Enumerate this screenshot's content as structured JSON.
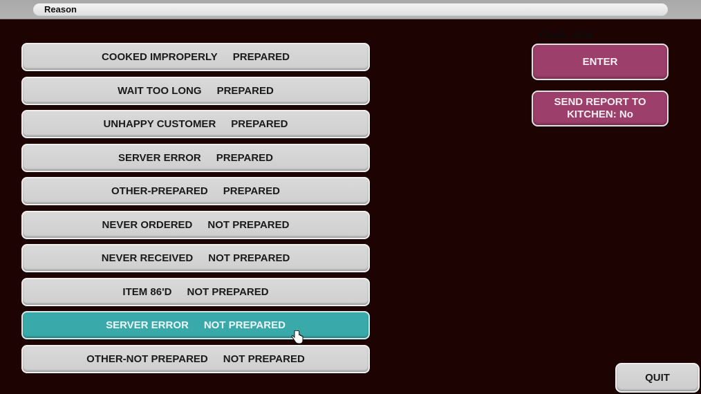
{
  "header": {
    "title": "Reason"
  },
  "check": {
    "label": "Check: 0004"
  },
  "reasons": [
    {
      "name": "COOKED IMPROPERLY",
      "status": "PREPARED",
      "selected": false
    },
    {
      "name": "WAIT TOO LONG",
      "status": "PREPARED",
      "selected": false
    },
    {
      "name": "UNHAPPY CUSTOMER",
      "status": "PREPARED",
      "selected": false
    },
    {
      "name": "SERVER ERROR",
      "status": "PREPARED",
      "selected": false
    },
    {
      "name": "OTHER-PREPARED",
      "status": "PREPARED",
      "selected": false
    },
    {
      "name": "NEVER ORDERED",
      "status": "NOT PREPARED",
      "selected": false
    },
    {
      "name": "NEVER RECEIVED",
      "status": "NOT PREPARED",
      "selected": false
    },
    {
      "name": "ITEM 86'D",
      "status": "NOT PREPARED",
      "selected": false
    },
    {
      "name": "SERVER ERROR",
      "status": "NOT PREPARED",
      "selected": true
    },
    {
      "name": "OTHER-NOT PREPARED",
      "status": "NOT PREPARED",
      "selected": false
    }
  ],
  "actions": {
    "enter_label": "ENTER",
    "send_report_line1": "SEND REPORT TO",
    "send_report_line2": "KITCHEN: No",
    "quit_label": "QUIT"
  },
  "colors": {
    "background": "#1e0303",
    "selected": "#3aa9a9",
    "accent_pink": "#9c3f6a",
    "button_gray": "#d4d4d4"
  }
}
